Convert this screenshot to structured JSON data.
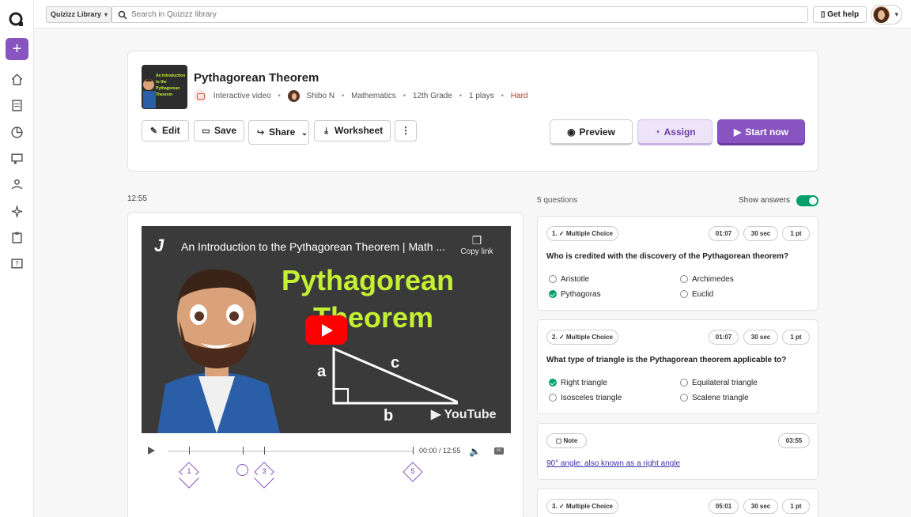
{
  "topbar": {
    "library_select": "Quizizz Library",
    "search_placeholder": "Search in Quizizz library",
    "get_help": "Get help"
  },
  "resource": {
    "title": "Pythagorean Theorem",
    "type": "Interactive video",
    "author": "Shibo N",
    "subject": "Mathematics",
    "grade": "12th Grade",
    "plays": "1 plays",
    "difficulty": "Hard",
    "thumb_text": "An Introduction to the Pythagorean Theorem"
  },
  "actions": {
    "edit": "Edit",
    "save": "Save",
    "share": "Share",
    "worksheet": "Worksheet",
    "more": "⋮",
    "preview": "Preview",
    "assign": "Assign",
    "start": "Start now"
  },
  "video": {
    "duration": "12:55",
    "title": "An Introduction to the Pythagorean Theorem | Math ...",
    "copy_link": "Copy link",
    "headline1": "Pythagorean",
    "headline2": "Theorem",
    "label_a": "a",
    "label_b": "b",
    "label_c": "c",
    "brand": "YouTube",
    "time": "00:00 / 12:55",
    "cc": "cc",
    "markers": [
      "1",
      "3",
      "5"
    ]
  },
  "questions_panel": {
    "count": "5 questions",
    "show_answers": "Show answers",
    "show_answers_on": true
  },
  "questions": [
    {
      "type": "1. ✓ Multiple Choice",
      "time": "01:07",
      "duration": "30 sec",
      "points": "1 pt",
      "text": "Who is credited with the discovery of the Pythagorean theorem?",
      "options": [
        "Aristotle",
        "Archimedes",
        "Pythagoras",
        "Euclid"
      ],
      "correct": 2
    },
    {
      "type": "2. ✓ Multiple Choice",
      "time": "01:07",
      "duration": "30 sec",
      "points": "1 pt",
      "text": "What type of triangle is the Pythagorean theorem applicable to?",
      "options": [
        "Right triangle",
        "Equilateral triangle",
        "Isosceles triangle",
        "Scalene triangle"
      ],
      "correct": 0
    }
  ],
  "note": {
    "label": "Note",
    "time": "03:55",
    "text": "90° angle: also known as a right angle"
  },
  "question3": {
    "type": "3. ✓ Multiple Choice",
    "time": "05:01",
    "duration": "30 sec",
    "points": "1 pt"
  },
  "colors": {
    "brand_purple": "#8854c0",
    "correct_green": "#00a06a",
    "hard_red": "#a3412b",
    "headline_green": "#c4f034"
  }
}
